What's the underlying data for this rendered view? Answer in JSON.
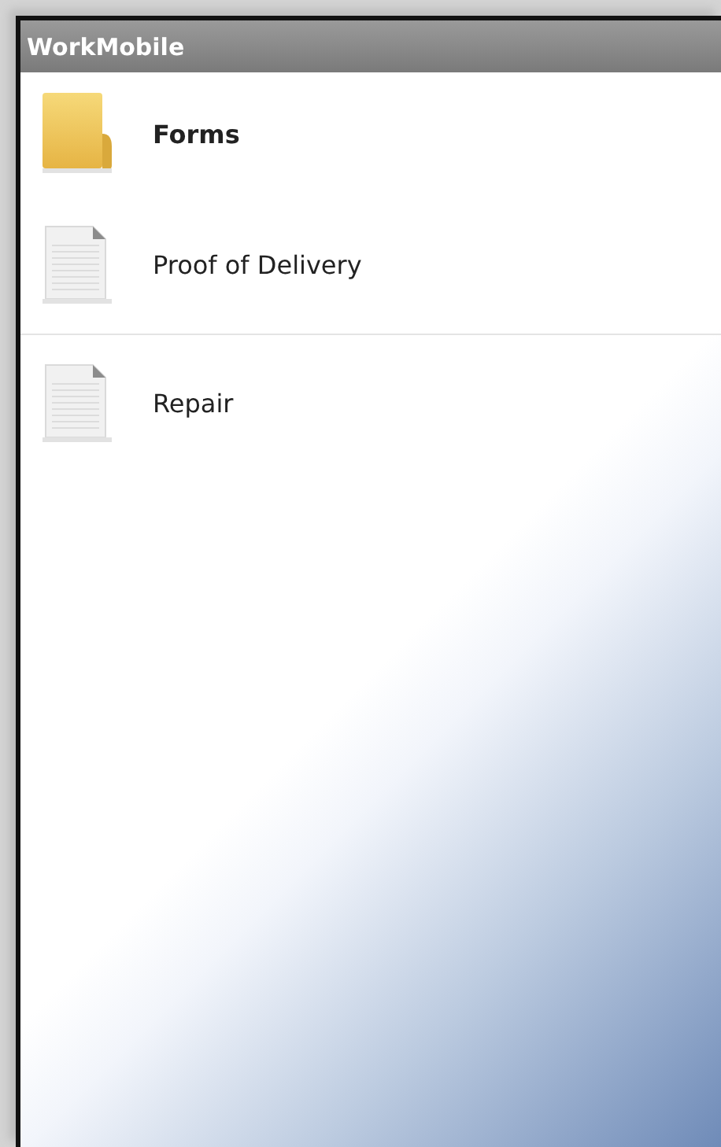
{
  "window": {
    "title": "WorkMobile"
  },
  "folder": {
    "label": "Forms",
    "kind": "folder"
  },
  "forms": [
    {
      "label": "Proof of Delivery",
      "kind": "document"
    },
    {
      "label": "Repair",
      "kind": "document"
    }
  ]
}
